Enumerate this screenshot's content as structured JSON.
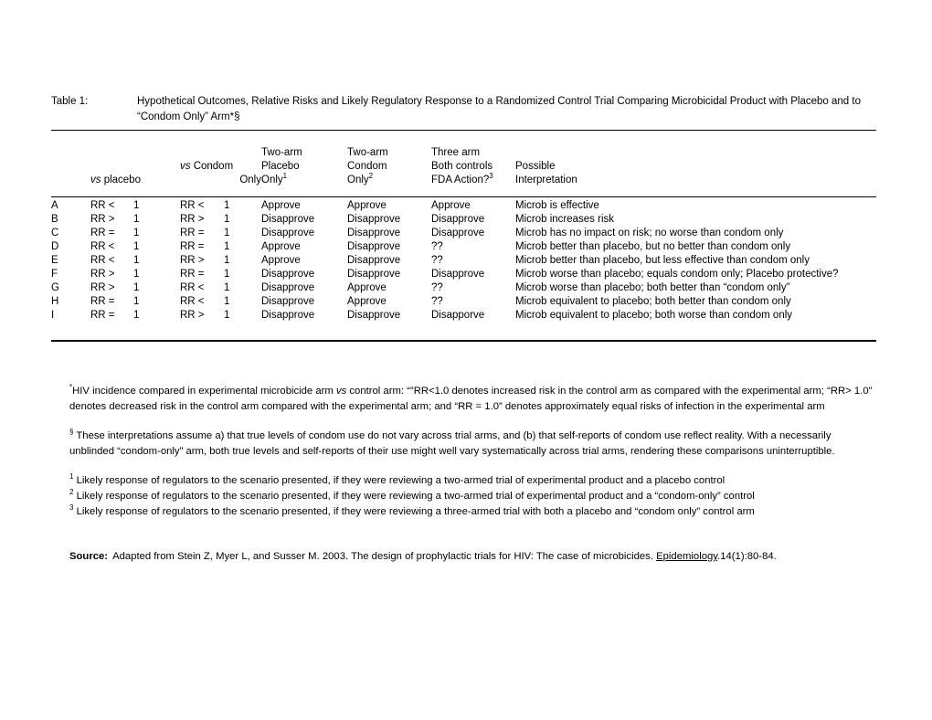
{
  "title": {
    "label": "Table 1:",
    "text": "Hypothetical Outcomes, Relative Risks and Likely Regulatory Response to a Randomized Control Trial Comparing Microbicidal Product with Placebo and to “Condom Only” Arm*§"
  },
  "table": {
    "headers": [
      {
        "lines": [
          ""
        ],
        "align": "left"
      },
      {
        "lines": [
          "",
          "vs placebo"
        ],
        "italic_first_word": true,
        "align": "left"
      },
      {
        "lines": [
          "",
          "vs Condom",
          "Only"
        ],
        "italic_first_word": true,
        "align": "left"
      },
      {
        "lines": [
          "Two-arm",
          "Placebo",
          "Only"
        ],
        "sup": "1",
        "align": "left"
      },
      {
        "lines": [
          "Two-arm",
          "Condom",
          "Only"
        ],
        "sup": "2",
        "align": "left"
      },
      {
        "lines": [
          "Three arm",
          "Both controls",
          "FDA Action?"
        ],
        "sup": "3",
        "align": "left"
      },
      {
        "lines": [
          "",
          "Possible",
          "Interpretation"
        ],
        "align": "left"
      }
    ],
    "header_col1_vs": "vs",
    "header_col1_rest": " placebo",
    "header_col2_vs": "vs",
    "header_col2_rest": " Condom",
    "header_col2_line3": "Only",
    "header_col3_l1": "Two-arm",
    "header_col3_l2": "Placebo",
    "header_col3_l3": "Only",
    "header_col3_sup": "1",
    "header_col4_l1": "Two-arm",
    "header_col4_l2": "Condom",
    "header_col4_l3": "Only",
    "header_col4_sup": "2",
    "header_col5_l1": "Three arm",
    "header_col5_l2": "Both controls",
    "header_col5_l3": "FDA Action?",
    "header_col5_sup": "3",
    "header_col6_l2": "Possible",
    "header_col6_l3": "Interpretation",
    "rows": [
      {
        "id": "A",
        "rr_placebo_op": "RR <",
        "rr_placebo_val": "1",
        "rr_condom_op": "RR <",
        "rr_condom_val": "1",
        "two_arm_placebo": "Approve",
        "two_arm_condom": "Approve",
        "three_arm": "Approve",
        "interpretation": "Microb is effective"
      },
      {
        "id": "B",
        "rr_placebo_op": "RR >",
        "rr_placebo_val": "1",
        "rr_condom_op": "RR >",
        "rr_condom_val": "1",
        "two_arm_placebo": "Disapprove",
        "two_arm_condom": "Disapprove",
        "three_arm": "Disapprove",
        "interpretation": "Microb increases risk"
      },
      {
        "id": "C",
        "rr_placebo_op": "RR =",
        "rr_placebo_val": "1",
        "rr_condom_op": "RR =",
        "rr_condom_val": "1",
        "two_arm_placebo": "Disapprove",
        "two_arm_condom": "Disapprove",
        "three_arm": "Disapprove",
        "interpretation": "Microb has no impact on risk; no worse than condom only"
      },
      {
        "id": "D",
        "rr_placebo_op": "RR <",
        "rr_placebo_val": "1",
        "rr_condom_op": "RR =",
        "rr_condom_val": "1",
        "two_arm_placebo": "Approve",
        "two_arm_condom": "Disapprove",
        "three_arm": "??",
        "interpretation": "Microb better than placebo, but no better than condom only"
      },
      {
        "id": "E",
        "rr_placebo_op": "RR <",
        "rr_placebo_val": "1",
        "rr_condom_op": "RR >",
        "rr_condom_val": "1",
        "two_arm_placebo": "Approve",
        "two_arm_condom": "Disapprove",
        "three_arm": "??",
        "interpretation": "Microb better than placebo, but less effective than condom only"
      },
      {
        "id": "F",
        "rr_placebo_op": "RR >",
        "rr_placebo_val": "1",
        "rr_condom_op": "RR =",
        "rr_condom_val": "1",
        "two_arm_placebo": "Disapprove",
        "two_arm_condom": "Disapprove",
        "three_arm": "Disapprove",
        "interpretation": "Microb worse than placebo; equals condom only; Placebo protective?"
      },
      {
        "id": "G",
        "rr_placebo_op": "RR >",
        "rr_placebo_val": "1",
        "rr_condom_op": "RR <",
        "rr_condom_val": "1",
        "two_arm_placebo": "Disapprove",
        "two_arm_condom": "Approve",
        "three_arm": "??",
        "interpretation": "Microb worse than placebo; both better than “condom only”"
      },
      {
        "id": "H",
        "rr_placebo_op": "RR =",
        "rr_placebo_val": "1",
        "rr_condom_op": "RR <",
        "rr_condom_val": "1",
        "two_arm_placebo": "Disapprove",
        "two_arm_condom": "Approve",
        "three_arm": "??",
        "interpretation": "Microb equivalent to placebo; both better than condom only"
      },
      {
        "id": "I",
        "rr_placebo_op": "RR =",
        "rr_placebo_val": "1",
        "rr_condom_op": "RR >",
        "rr_condom_val": "1",
        "two_arm_placebo": "Disapprove",
        "two_arm_condom": "Disapprove",
        "three_arm": "Disapporve",
        "interpretation": "Microb equivalent to placebo; both worse than condom only"
      }
    ]
  },
  "notes": {
    "asterisk_marker": "*",
    "asterisk_part1": "HIV incidence compared in experimental microbicide arm ",
    "asterisk_vs": "vs",
    "asterisk_part2": " control arm: “”RR<1.0 denotes increased risk in the control arm as compared with the experimental arm; “RR> 1.0” denotes decreased risk in the control arm compared with the experimental arm; and “RR = 1.0” denotes approximately equal risks of infection in the experimental arm",
    "section_marker": "§",
    "section_text": " These interpretations assume a) that true levels of condom use do not vary across trial arms, and (b) that self-reports of condom use reflect reality.  With a necessarily unblinded “condom-only” arm, both true levels and self-reports of their use might well vary systematically across trial arms, rendering these comparisons uninterruptible.",
    "numbered": [
      {
        "marker": "1",
        "text": "Likely response of regulators to the scenario presented, if they were reviewing a two-armed trial of experimental product and a placebo control"
      },
      {
        "marker": "2",
        "text": "Likely response of regulators to the scenario presented, if they were reviewing a two-armed trial of experimental product and a “condom-only” control"
      },
      {
        "marker": "3",
        "text": "Likely response of regulators to the scenario presented, if they were reviewing a three-armed trial with both a placebo and “condom only” control arm"
      }
    ]
  },
  "source": {
    "label": "Source:",
    "part1": "Adapted from Stein Z, Myer L, and Susser M. 2003. The design of prophylactic trials for HIV: The case of microbicides. ",
    "journal": "Epidemiology",
    "part2": ".14(1):80-84."
  }
}
